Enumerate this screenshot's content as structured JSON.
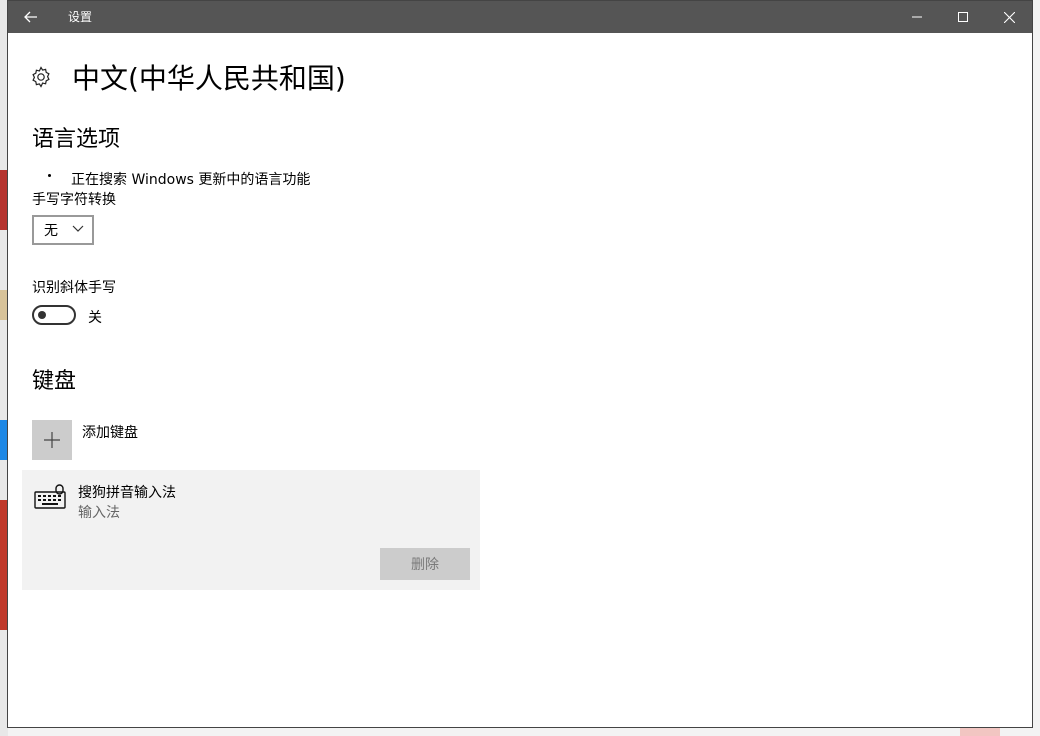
{
  "window": {
    "title": "设置"
  },
  "page": {
    "title": "中文(中华人民共和国)"
  },
  "language_options": {
    "heading": "语言选项",
    "searching_text": "正在搜索 Windows 更新中的语言功能",
    "handwriting_label": "手写字符转换",
    "handwriting_value": "无",
    "italic_label": "识别斜体手写",
    "italic_toggle_state": "关",
    "italic_toggle_on": false
  },
  "keyboard": {
    "heading": "键盘",
    "add_label": "添加键盘",
    "items": [
      {
        "name": "搜狗拼音输入法",
        "type": "输入法",
        "remove_label": "删除"
      }
    ]
  },
  "icons": {
    "back": "back-arrow-icon",
    "minimize": "minimize-icon",
    "maximize": "maximize-icon",
    "close": "close-icon",
    "settings": "gear-icon",
    "dropdown": "chevron-down-icon",
    "add": "plus-icon",
    "keyboard": "keyboard-icon"
  },
  "colors": {
    "titlebar": "#555555",
    "disabled_button": "#cccccc",
    "card_bg": "#f2f2f2"
  }
}
